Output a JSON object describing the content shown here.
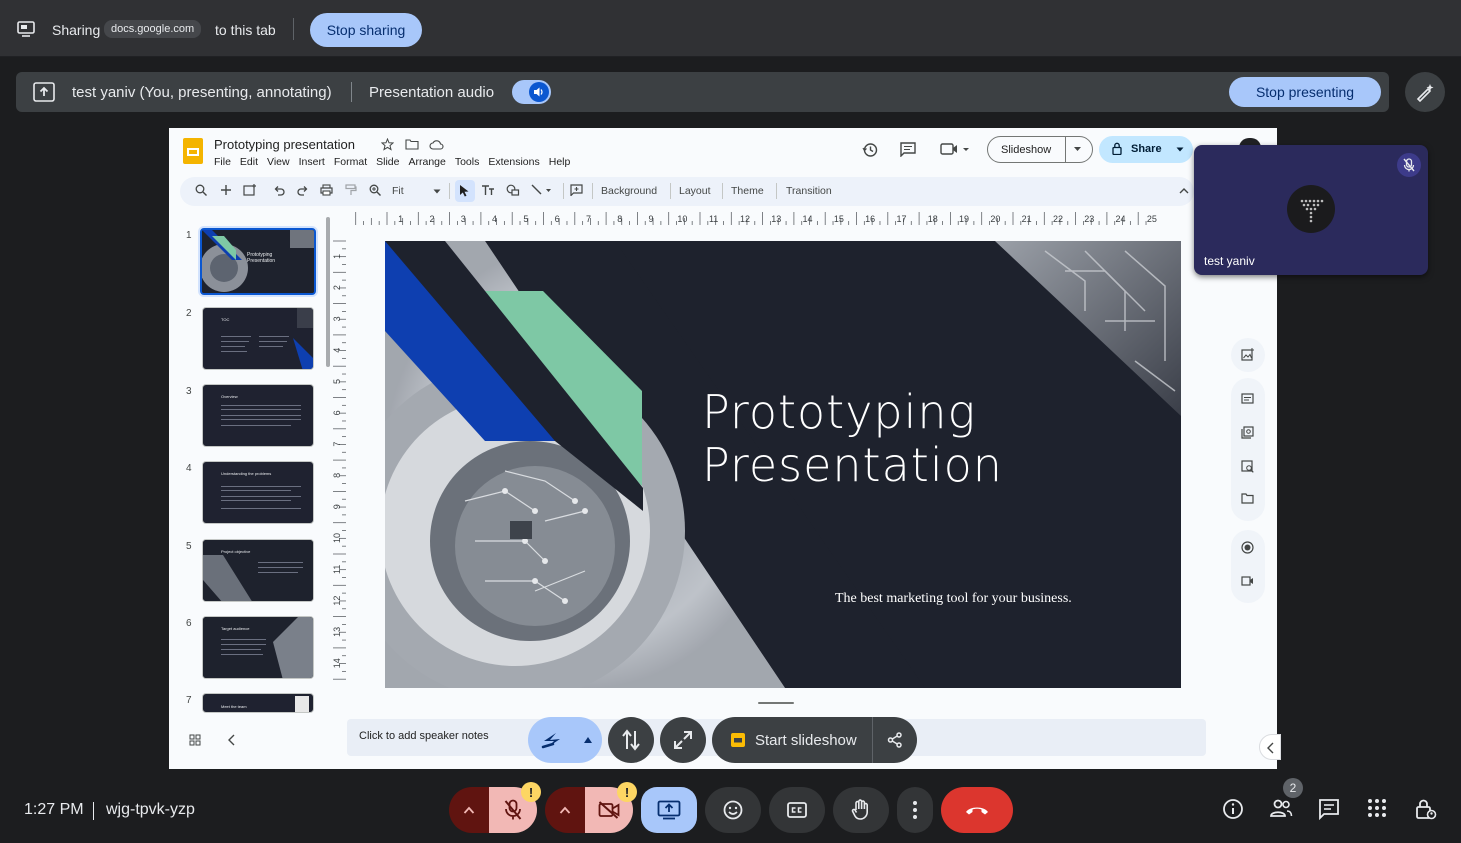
{
  "share_bar": {
    "sharing_label": "Sharing",
    "domain": "docs.google.com",
    "to_tab": "to this tab",
    "stop_sharing": "Stop sharing"
  },
  "present_bar": {
    "presenter": "test yaniv (You, presenting, annotating)",
    "audio_label": "Presentation audio",
    "audio_on": true,
    "stop_presenting": "Stop presenting"
  },
  "slides": {
    "doc_title": "Prototyping presentation",
    "menus": [
      "File",
      "Edit",
      "View",
      "Insert",
      "Format",
      "Slide",
      "Arrange",
      "Tools",
      "Extensions",
      "Help"
    ],
    "slideshow_label": "Slideshow",
    "share_label": "Share",
    "toolbar": {
      "zoom": "Fit",
      "background": "Background",
      "layout": "Layout",
      "theme": "Theme",
      "transition": "Transition"
    },
    "thumbnails": [
      {
        "num": "1",
        "title": "Prototyping Presentation"
      },
      {
        "num": "2",
        "title": "TOC"
      },
      {
        "num": "3",
        "title": "Overview"
      },
      {
        "num": "4",
        "title": "Understanding the problems"
      },
      {
        "num": "5",
        "title": "Project objective"
      },
      {
        "num": "6",
        "title": "Target audience"
      },
      {
        "num": "7",
        "title": "Meet the team"
      }
    ],
    "ruler_h": [
      "1",
      "2",
      "3",
      "4",
      "5",
      "6",
      "7",
      "8",
      "9",
      "10",
      "11",
      "12",
      "13",
      "14",
      "15",
      "16",
      "17",
      "18",
      "19",
      "20",
      "21",
      "22",
      "23",
      "24",
      "25"
    ],
    "ruler_v": [
      "1",
      "2",
      "3",
      "4",
      "5",
      "6",
      "7",
      "8",
      "9",
      "10",
      "11",
      "12",
      "13",
      "14"
    ],
    "slide_title_line1": "Prototyping",
    "slide_title_line2": "Presentation",
    "slide_subtitle": "The best marketing tool for your business.",
    "notes_placeholder": "Click to add speaker notes",
    "start_slideshow": "Start slideshow"
  },
  "self_tile": {
    "name": "test yaniv"
  },
  "bottom_bar": {
    "time": "1:27 PM",
    "meeting_code": "wjg-tpvk-yzp",
    "people_count": "2",
    "warn_symbol": "!"
  },
  "colors": {
    "accent": "#a8c7fa",
    "leave": "#dc362e",
    "muted_bg": "#f2b8b5",
    "slide_bg": "#1e222d",
    "slide_blue": "#0e3fb0",
    "slide_green": "#7ec8a5"
  }
}
